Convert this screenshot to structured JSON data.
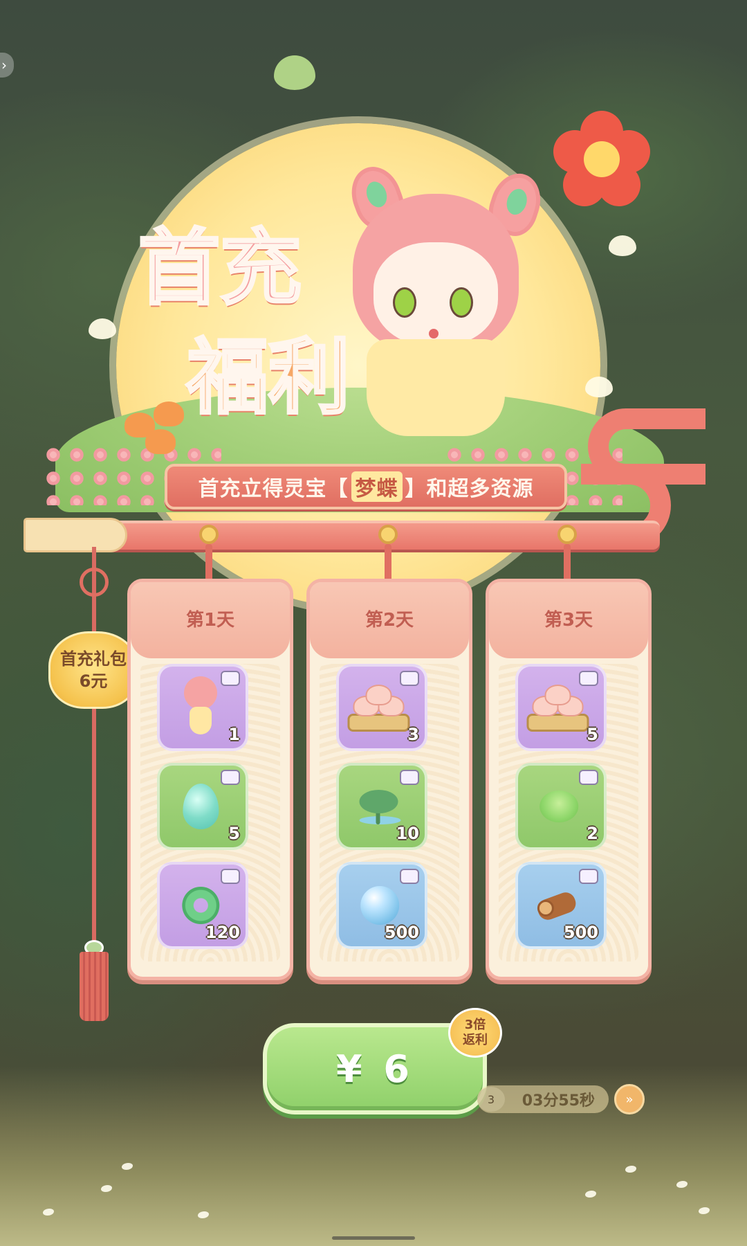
{
  "header": {
    "title_line1": "首充",
    "title_line2": "福利",
    "banner_prefix": "首充立得灵宝",
    "banner_highlight": "梦蝶",
    "banner_suffix": "和超多资源"
  },
  "gift_badge": {
    "line1": "首充礼包",
    "line2": "6元"
  },
  "days": [
    {
      "label": "第1天",
      "items": [
        {
          "icon": "character-icon",
          "quantity": "1",
          "bg": "#c9a6e8"
        },
        {
          "icon": "spirit-drop-icon",
          "quantity": "5",
          "bg": "#98ce70"
        },
        {
          "icon": "jade-ring-icon",
          "quantity": "120",
          "bg": "#c9a6e8"
        }
      ]
    },
    {
      "label": "第2天",
      "items": [
        {
          "icon": "bun-tray-icon",
          "quantity": "3",
          "bg": "#c9a6e8"
        },
        {
          "icon": "lotus-leaf-icon",
          "quantity": "10",
          "bg": "#98ce70"
        },
        {
          "icon": "water-orb-icon",
          "quantity": "500",
          "bg": "#99c6ea"
        }
      ]
    },
    {
      "label": "第3天",
      "items": [
        {
          "icon": "bun-tray-icon",
          "quantity": "5",
          "bg": "#c9a6e8"
        },
        {
          "icon": "cabbage-icon",
          "quantity": "2",
          "bg": "#98ce70"
        },
        {
          "icon": "wood-log-icon",
          "quantity": "500",
          "bg": "#99c6ea"
        }
      ]
    }
  ],
  "buy_button": {
    "label": "¥ 6"
  },
  "rebate_badge": {
    "line1": "3倍",
    "line2": "返利"
  },
  "timer": {
    "count": "3",
    "text": "03分55秒"
  },
  "colors": {
    "accent_pink": "#ee7f72",
    "banner_red": "#e06f62",
    "button_green": "#8fd06a",
    "card_cream": "#fbf0dc",
    "gold": "#f5c34e"
  }
}
